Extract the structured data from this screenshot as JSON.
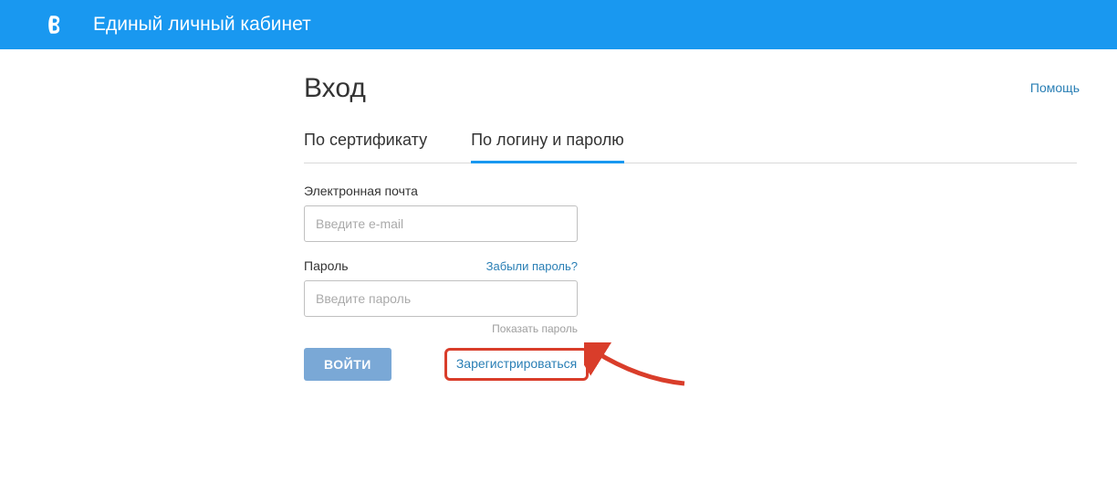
{
  "header": {
    "title": "Единый личный кабинет"
  },
  "page": {
    "title": "Вход",
    "help": "Помощь"
  },
  "tabs": {
    "certificate": "По сертификату",
    "login": "По логину и паролю"
  },
  "form": {
    "email_label": "Электронная почта",
    "email_placeholder": "Введите e-mail",
    "password_label": "Пароль",
    "forgot": "Забыли пароль?",
    "password_placeholder": "Введите пароль",
    "show_password": "Показать пароль",
    "login_button": "ВОЙТИ",
    "register": "Зарегистрироваться"
  }
}
